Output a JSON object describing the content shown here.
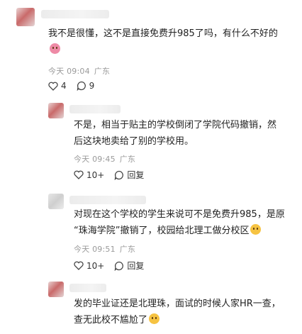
{
  "comments": [
    {
      "text": "我不是很懂，这不是直接免费升985了吗，有什么不好的",
      "emoji": "crying-face-emoji",
      "time": "今天 09:04",
      "location": "广东",
      "likes": "4",
      "replies": "9"
    },
    {
      "line1": "不是，相当于贴主的学校倒闭了学院代码撤销，然",
      "line2": "后这块地卖给了别的学校用。",
      "time": "今天 09:45",
      "location": "广东",
      "likes": "10+",
      "reply_label": "回复"
    },
    {
      "line1": "对现在这个学校的学生来说可不是免费升985，是原",
      "line2": "“珠海学院”撤销了，校园给北理工做分校区",
      "emoji": "smirk-emoji",
      "time": "今天 09:51",
      "location": "广东",
      "likes": "10+",
      "reply_label": "回复"
    },
    {
      "line1": "发的毕业证还是北理珠，面试的时候人家HR一查，",
      "line2": "查无此校不尴尬了",
      "emoji": "smirk-emoji"
    }
  ]
}
